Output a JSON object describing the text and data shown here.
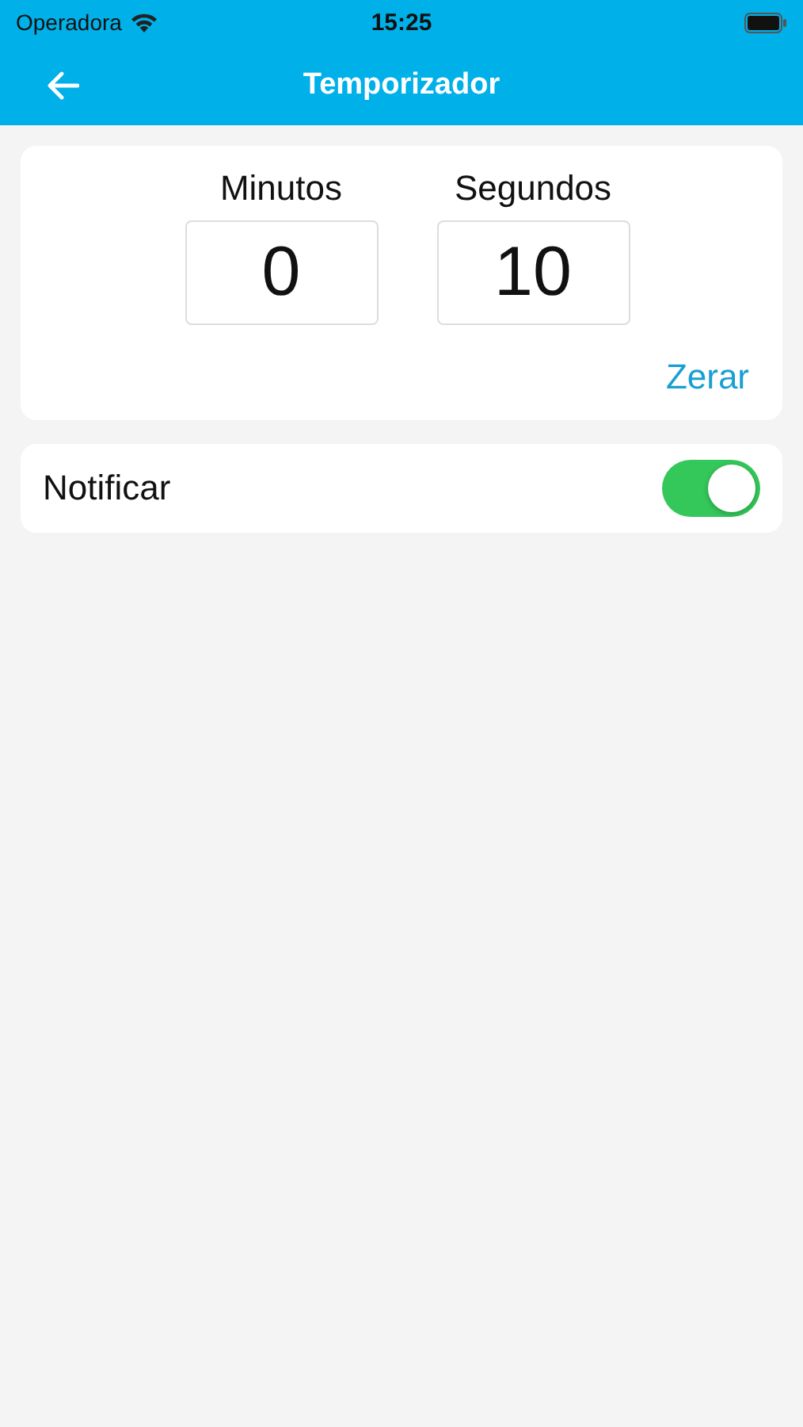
{
  "status_bar": {
    "carrier": "Operadora",
    "time": "15:25"
  },
  "header": {
    "title": "Temporizador"
  },
  "timer": {
    "fields": [
      {
        "label": "Minutos",
        "value": "0"
      },
      {
        "label": "Segundos",
        "value": "10"
      }
    ],
    "reset_button": "Zerar"
  },
  "notify": {
    "label": "Notificar",
    "on": true
  }
}
